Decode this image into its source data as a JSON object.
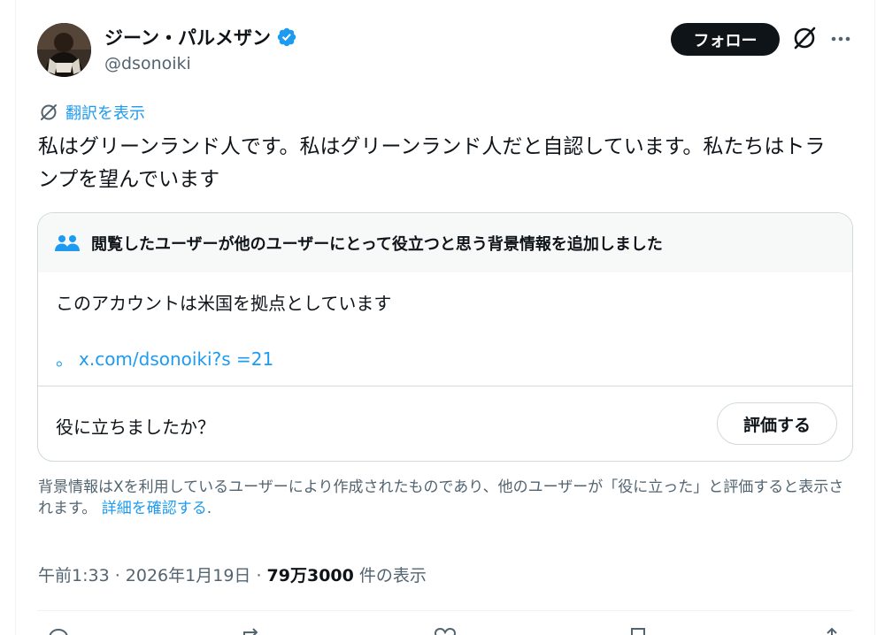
{
  "author": {
    "display_name": "ジーン・パルメザン",
    "handle": "@dsonoiki",
    "verified": true
  },
  "header": {
    "follow_label": "フォロー",
    "grok_icon": "grok-icon",
    "more_icon": "more-icon"
  },
  "translate": {
    "label": "翻訳を表示"
  },
  "tweet": {
    "text": "私はグリーンランド人です。私はグリーンランド人だと自認しています。私たちはトランプを望んでいます"
  },
  "community_note": {
    "header": "閲覧したユーザーが他のユーザーにとって役立つと思う背景情報を追加しました",
    "body": "このアカウントは米国を拠点としています",
    "link_prefix": "。",
    "link_text": "x.com/dsonoiki?s =21",
    "helpful_question": "役に立ちましたか？",
    "rate_label": "評価する"
  },
  "disclaimer": {
    "text": "背景情報はXを利用しているユーザーにより作成されたものであり、他のユーザーが「役に立った」と評価すると表示されます。 ",
    "link": "詳細を確認する",
    "suffix": "."
  },
  "meta": {
    "time": "午前1:33",
    "sep1": " · ",
    "date": "2026年1月19日",
    "sep2": " · ",
    "views": "79万3000",
    "views_suffix": " 件の表示"
  },
  "colors": {
    "accent": "#1d9bf0",
    "text_primary": "#0f1419",
    "text_secondary": "#536471",
    "border": "#cfd9de"
  }
}
